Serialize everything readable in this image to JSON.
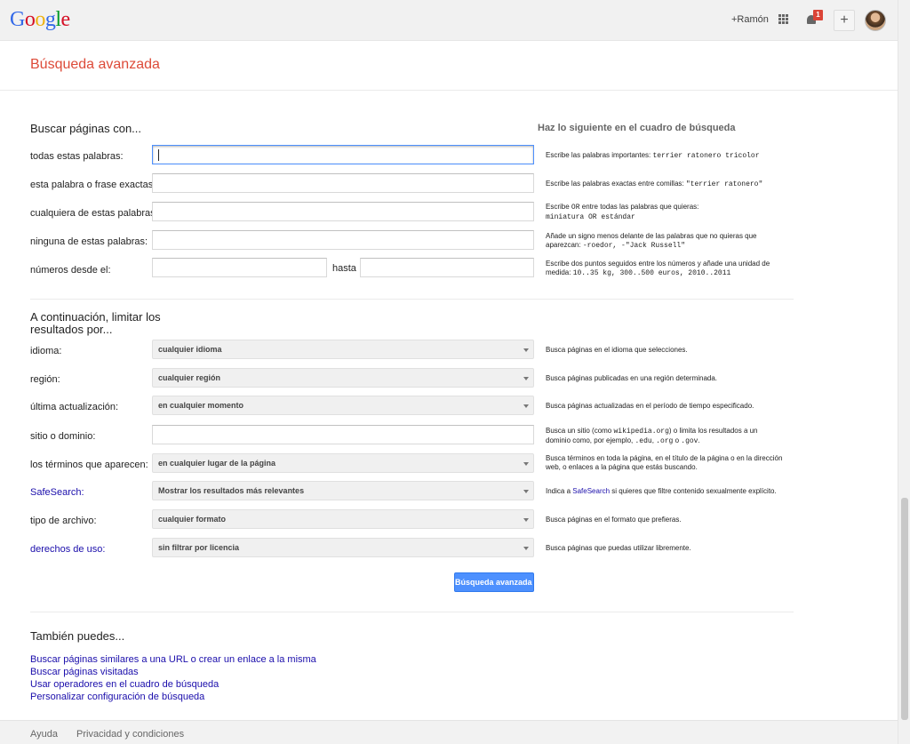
{
  "header": {
    "logo_letters": [
      {
        "char": "G",
        "color": "#3369e8"
      },
      {
        "char": "o",
        "color": "#d50f25"
      },
      {
        "char": "o",
        "color": "#eeb211"
      },
      {
        "char": "g",
        "color": "#3369e8"
      },
      {
        "char": "l",
        "color": "#009925"
      },
      {
        "char": "e",
        "color": "#d50f25"
      }
    ],
    "user_link": "+Ramón",
    "notification_count": "1",
    "plus_label": "+"
  },
  "page_title": "Búsqueda avanzada",
  "search_section": {
    "title": "Buscar páginas con...",
    "help_title": "Haz lo siguiente en el cuadro de búsqueda",
    "fields": [
      {
        "label": "todas estas palabras:",
        "hint_line1": "Escribe las palabras importantes: ",
        "hint_mono1": "terrier ratonero tricolor",
        "hint_line2": "",
        "hint_mono2": ""
      },
      {
        "label": "esta palabra o frase exactas:",
        "hint_line1": "Escribe las palabras exactas entre comillas: ",
        "hint_mono1": "\"terrier ratonero\"",
        "hint_line2": "",
        "hint_mono2": ""
      },
      {
        "label": "cualquiera de estas palabras:",
        "hint_line1": "Escribe ",
        "hint_mono1": "OR",
        "hint_line1b": " entre todas las palabras que quieras:",
        "hint_line2": "",
        "hint_mono2": "miniatura OR estándar"
      },
      {
        "label": "ninguna de estas palabras:",
        "hint_line1": "Añade un signo menos delante de las palabras que no quieras que",
        "hint_mono1": "",
        "hint_line2": "aparezcan: ",
        "hint_mono2": "-roedor, -\"Jack Russell\""
      },
      {
        "label": "números desde el:",
        "hint_line1": "Escribe dos puntos seguidos entre los números y añade una unidad de",
        "hint_mono1": "",
        "hint_line2": "medida: ",
        "hint_mono2": "10..35 kg, 300..500 euros, 2010..2011"
      }
    ],
    "hasta_label": "hasta"
  },
  "limit_section": {
    "title_line1": "A continuación, limitar los",
    "title_line2": "resultados por...",
    "rows": [
      {
        "label": "idioma:",
        "value": "cualquier idioma",
        "hint": "Busca páginas en el idioma que selecciones."
      },
      {
        "label": "región:",
        "value": "cualquier región",
        "hint": "Busca páginas publicadas en una región determinada."
      },
      {
        "label": "última actualización:",
        "value": "en cualquier momento",
        "hint": "Busca páginas actualizadas en el período de tiempo especificado."
      },
      {
        "label": "sitio o dominio:",
        "value": "",
        "hint_line1a": "Busca un sitio (como ",
        "hint_mono1": "wikipedia.org",
        "hint_line1b": ") o limita los resultados a un",
        "hint_line2a": "dominio como, por ejemplo, ",
        "hint_mono2a": ".edu",
        "hint_mono2b": ".org",
        "hint_mono2c": ".gov",
        "hint_o": " o ",
        "hint_comma": ", "
      },
      {
        "label": "los términos que aparecen:",
        "value": "en cualquier lugar de la página",
        "hint_line1": "Busca términos en toda la página, en el título de la página o en la dirección",
        "hint_line2": "web, o enlaces a la página que estás buscando."
      },
      {
        "label": "SafeSearch:",
        "value": "Mostrar los resultados más relevantes",
        "hint_a": "Indica a ",
        "hint_link": "SafeSearch",
        "hint_b": " si quieres que filtre contenido sexualmente explícito."
      },
      {
        "label": "tipo de archivo:",
        "value": "cualquier formato",
        "hint": "Busca páginas en el formato que prefieras."
      },
      {
        "label": "derechos de uso:",
        "value": "sin filtrar por licencia",
        "hint": "Busca páginas que puedas utilizar libremente."
      }
    ],
    "submit_label": "Búsqueda avanzada"
  },
  "also_section": {
    "title": "También puedes...",
    "links": [
      "Buscar páginas similares a una URL o crear un enlace a la misma",
      "Buscar páginas visitadas",
      "Usar operadores en el cuadro de búsqueda",
      "Personalizar configuración de búsqueda"
    ]
  },
  "footer": {
    "help": "Ayuda",
    "privacy": "Privacidad y condiciones"
  }
}
